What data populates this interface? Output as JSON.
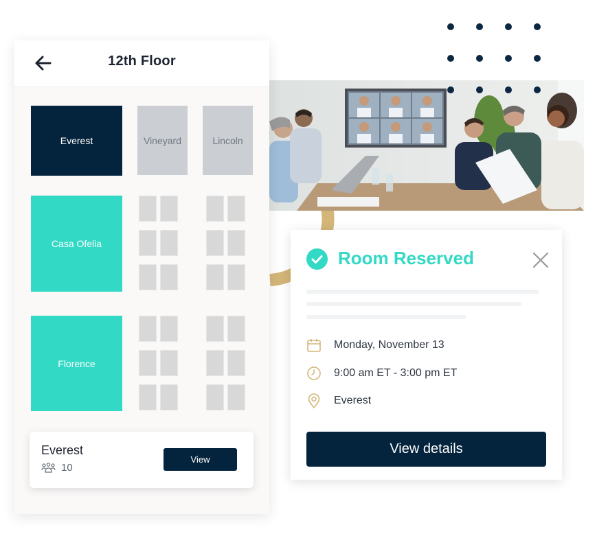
{
  "floor": {
    "title": "12th Floor",
    "back_icon": "arrow-left-icon",
    "rooms": [
      {
        "name": "Everest",
        "status": "selected"
      },
      {
        "name": "Vineyard",
        "status": "unavailable"
      },
      {
        "name": "Lincoln",
        "status": "unavailable"
      },
      {
        "name": "Casa Ofelia",
        "status": "available"
      },
      {
        "name": "Florence",
        "status": "available"
      }
    ],
    "selected_room": {
      "name": "Everest",
      "capacity_icon": "people-group-icon",
      "capacity": "10",
      "view_label": "View"
    }
  },
  "photo": {
    "description": "Team in conference room on a video call"
  },
  "reservation": {
    "status_icon": "check-circle-icon",
    "title": "Room Reserved",
    "close_icon": "close-icon",
    "date_icon": "calendar-icon",
    "date": "Monday, November 13",
    "time_icon": "clock-icon",
    "time": "9:00 am ET - 3:00 pm ET",
    "location_icon": "map-pin-icon",
    "location": "Everest",
    "details_label": "View details"
  },
  "colors": {
    "navy": "#04233d",
    "teal": "#32d9c5",
    "gold": "#d4b679",
    "unavailable": "#cbcfd4",
    "desk": "#d8d8d8"
  }
}
